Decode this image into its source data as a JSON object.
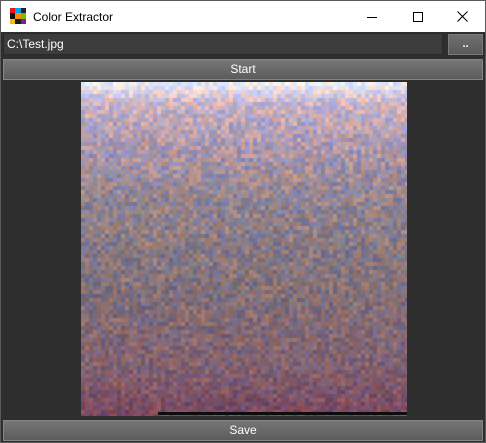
{
  "window": {
    "title": "Color Extractor",
    "icon": "color-grid-icon",
    "controls": [
      "minimize-icon",
      "maximize-icon",
      "close-icon"
    ]
  },
  "path": {
    "value": "C:\\Test.jpg"
  },
  "browse_button": {
    "label": ".."
  },
  "start_button": {
    "label": "Start"
  },
  "save_button": {
    "label": "Save"
  },
  "colors": {
    "background": "#2e2e2e",
    "button": "#696969",
    "titlebar": "#ffffff",
    "preview_top": "#e9e8f4",
    "preview_mid": "#8c7b86",
    "preview_bottom": "#84485e"
  }
}
